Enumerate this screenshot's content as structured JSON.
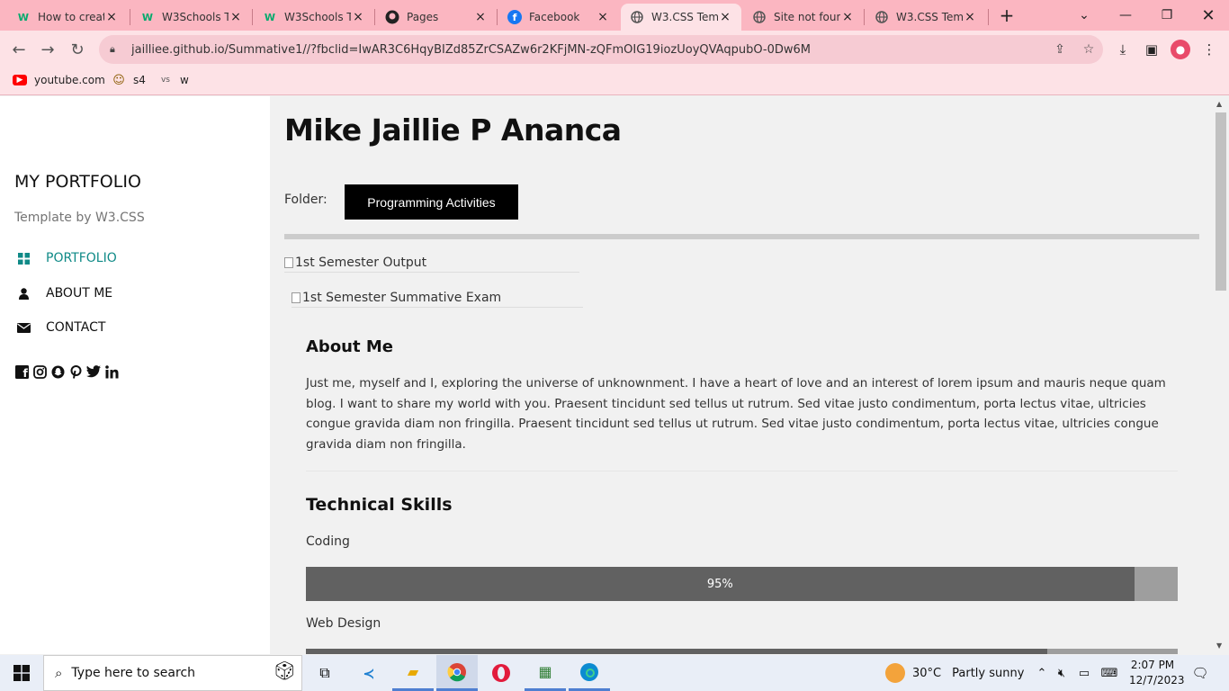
{
  "browser": {
    "tabs": [
      {
        "title": "How to creat",
        "favicon": "W",
        "favicon_color": "#04aa6d",
        "active": false
      },
      {
        "title": "W3Schools T",
        "favicon": "W",
        "favicon_color": "#04aa6d",
        "active": false
      },
      {
        "title": "W3Schools T",
        "favicon": "W",
        "favicon_color": "#04aa6d",
        "active": false
      },
      {
        "title": "Pages",
        "favicon": "github-icon",
        "active": false
      },
      {
        "title": "Facebook",
        "favicon": "f",
        "favicon_color": "#1877f2",
        "active": false
      },
      {
        "title": "W3.CSS Tem",
        "favicon": "globe-icon",
        "active": true
      },
      {
        "title": "Site not foun",
        "favicon": "globe-icon",
        "active": false
      },
      {
        "title": "W3.CSS Tem",
        "favicon": "globe-icon",
        "active": false
      }
    ],
    "url": "jailliee.github.io/Summative1//?fbclid=IwAR3C6HqyBIZd85ZrCSAZw6r2KFjMN-zQFmOIG19iozUoyQVAqpubO-0Dw6M",
    "bookmarks": [
      {
        "label": "youtube.com",
        "icon": "youtube-icon"
      },
      {
        "label": "s4",
        "icon": "ghost-icon"
      },
      {
        "label": "w",
        "icon": "vs-icon"
      }
    ]
  },
  "sidebar": {
    "brand": "MY PORTFOLIO",
    "subtitle": "Template by W3.CSS",
    "links": [
      {
        "label": "PORTFOLIO",
        "icon": "grid-icon",
        "active": true
      },
      {
        "label": "ABOUT ME",
        "icon": "user-icon",
        "active": false
      },
      {
        "label": "CONTACT",
        "icon": "envelope-icon",
        "active": false
      }
    ],
    "socials": [
      "facebook-icon",
      "instagram-icon",
      "snapchat-icon",
      "pinterest-icon",
      "twitter-icon",
      "linkedin-icon"
    ]
  },
  "main": {
    "name": "Mike Jaillie P Ananca",
    "folder_label": "Folder:",
    "folder_button": "Programming Activities",
    "images": [
      {
        "alt": "1st Semester Output"
      },
      {
        "alt": "1st Semester Summative Exam"
      }
    ],
    "about": {
      "title": "About Me",
      "text": "Just me, myself and I, exploring the universe of unknownment. I have a heart of love and an interest of lorem ipsum and mauris neque quam blog. I want to share my world with you. Praesent tincidunt sed tellus ut rutrum. Sed vitae justo condimentum, porta lectus vitae, ultricies congue gravida diam non fringilla. Praesent tincidunt sed tellus ut rutrum. Sed vitae justo condimentum, porta lectus vitae, ultricies congue gravida diam non fringilla."
    },
    "skills": {
      "title": "Technical Skills",
      "items": [
        {
          "label": "Coding",
          "percent": 95,
          "percent_label": "95%"
        },
        {
          "label": "Web Design",
          "percent": 85,
          "percent_label": ""
        }
      ]
    }
  },
  "taskbar": {
    "search_placeholder": "Type here to search",
    "apps": [
      "task-view-icon",
      "vscode-icon",
      "file-explorer-icon",
      "chrome-icon",
      "opera-icon",
      "spreadsheet-icon",
      "edge-icon"
    ],
    "weather_temp": "30°C",
    "weather_desc": "Partly sunny",
    "time": "2:07 PM",
    "date": "12/7/2023"
  }
}
